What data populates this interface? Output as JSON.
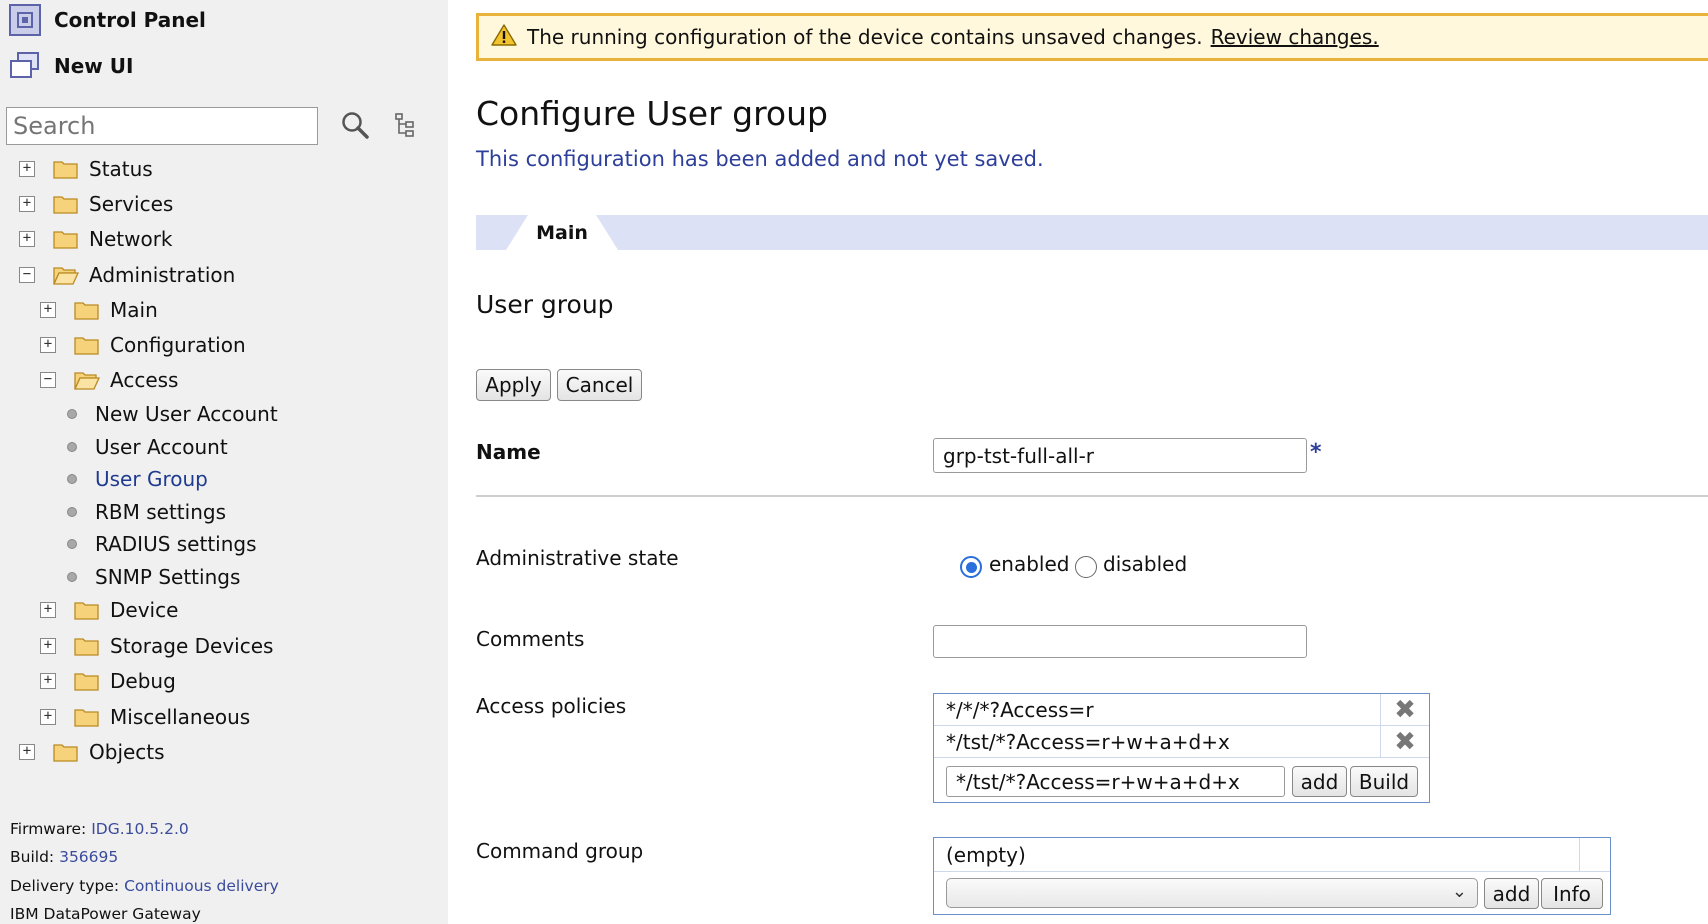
{
  "sidebar": {
    "control_panel": "Control Panel",
    "new_ui": "New UI",
    "search_placeholder": "Search",
    "tree": [
      {
        "label": "Status",
        "toggle": "+"
      },
      {
        "label": "Services",
        "toggle": "+"
      },
      {
        "label": "Network",
        "toggle": "+"
      },
      {
        "label": "Administration",
        "toggle": "−"
      },
      {
        "label": "Main",
        "toggle": "+"
      },
      {
        "label": "Configuration",
        "toggle": "+"
      },
      {
        "label": "Access",
        "toggle": "−"
      },
      {
        "label": "New User Account"
      },
      {
        "label": "User Account"
      },
      {
        "label": "User Group"
      },
      {
        "label": "RBM settings"
      },
      {
        "label": "RADIUS settings"
      },
      {
        "label": "SNMP Settings"
      },
      {
        "label": "Device",
        "toggle": "+"
      },
      {
        "label": "Storage Devices",
        "toggle": "+"
      },
      {
        "label": "Debug",
        "toggle": "+"
      },
      {
        "label": "Miscellaneous",
        "toggle": "+"
      },
      {
        "label": "Objects",
        "toggle": "+"
      }
    ],
    "info": {
      "firmware_label": "Firmware:",
      "firmware_value": "IDG.10.5.2.0",
      "build_label": "Build:",
      "build_value": "356695",
      "delivery_label": "Delivery type:",
      "delivery_value": "Continuous delivery",
      "product": "IBM DataPower Gateway"
    }
  },
  "warning": {
    "text": "The running configuration of the device contains unsaved changes.",
    "link": "Review changes."
  },
  "main": {
    "title": "Configure User group",
    "subtitle": "This configuration has been added and not yet saved.",
    "tab": "Main",
    "section": "User group",
    "apply": "Apply",
    "cancel": "Cancel",
    "name_label": "Name",
    "name_value": "grp-tst-full-all-r",
    "required_mark": "*",
    "admin_state_label": "Administrative state",
    "admin_state_options": [
      "enabled",
      "disabled"
    ],
    "admin_state_selected": "enabled",
    "comments_label": "Comments",
    "comments_value": "",
    "access_policies_label": "Access policies",
    "access_policies": [
      "*/*/*?Access=r",
      "*/tst/*?Access=r+w+a+d+x"
    ],
    "access_policy_input": "*/tst/*?Access=r+w+a+d+x",
    "add": "add",
    "build": "Build",
    "command_group_label": "Command group",
    "command_group_value": "(empty)",
    "command_group_select": "",
    "info": "Info"
  },
  "colors": {
    "sidebar_bg": "#f0f0f0",
    "warning_border": "#e9b23a",
    "warning_bg": "#fff8dc",
    "link_blue": "#2d3f9a",
    "tab_strip": "#dde1f5",
    "radio_blue": "#2a6fdb"
  }
}
